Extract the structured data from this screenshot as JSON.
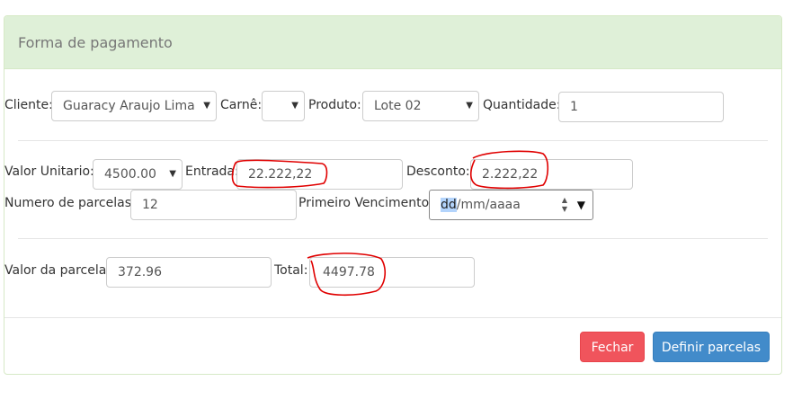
{
  "panel": {
    "title": "Forma de pagamento"
  },
  "row1": {
    "cliente_label": "Cliente:",
    "cliente_value": "Guaracy Araujo Lima",
    "carne_label": "Carnê:",
    "carne_value": "",
    "produto_label": "Produto:",
    "produto_value": "Lote 02",
    "quantidade_label": "Quantidade:",
    "quantidade_value": "1"
  },
  "row2": {
    "valor_unitario_label": "Valor Unitario:",
    "valor_unitario_value": "4500.00",
    "entrada_label": "Entrada:",
    "entrada_value": "22.222,22",
    "desconto_label": "Desconto:",
    "desconto_value": "2.222,22"
  },
  "row3": {
    "parcelas_label": "Numero de parcelas:",
    "parcelas_value": "12",
    "vencimento_label": "Primeiro Vencimento:",
    "vencimento_dd": "dd",
    "vencimento_rest": "/mm/aaaa"
  },
  "row4": {
    "valor_parcela_label": "Valor da parcela:",
    "valor_parcela_value": "372.96",
    "total_label": "Total:",
    "total_value": "4497.78"
  },
  "footer": {
    "fechar_label": "Fechar",
    "definir_label": "Definir parcelas"
  },
  "icons": {
    "select_caret": "caret-down-icon",
    "spinner": "spinner-arrows-icon",
    "date_dropdown": "triangle-down-icon"
  },
  "colors": {
    "heading_bg": "#dff0d8",
    "danger": "#f0545c",
    "primary": "#428bca",
    "annotation": "#e00000"
  }
}
